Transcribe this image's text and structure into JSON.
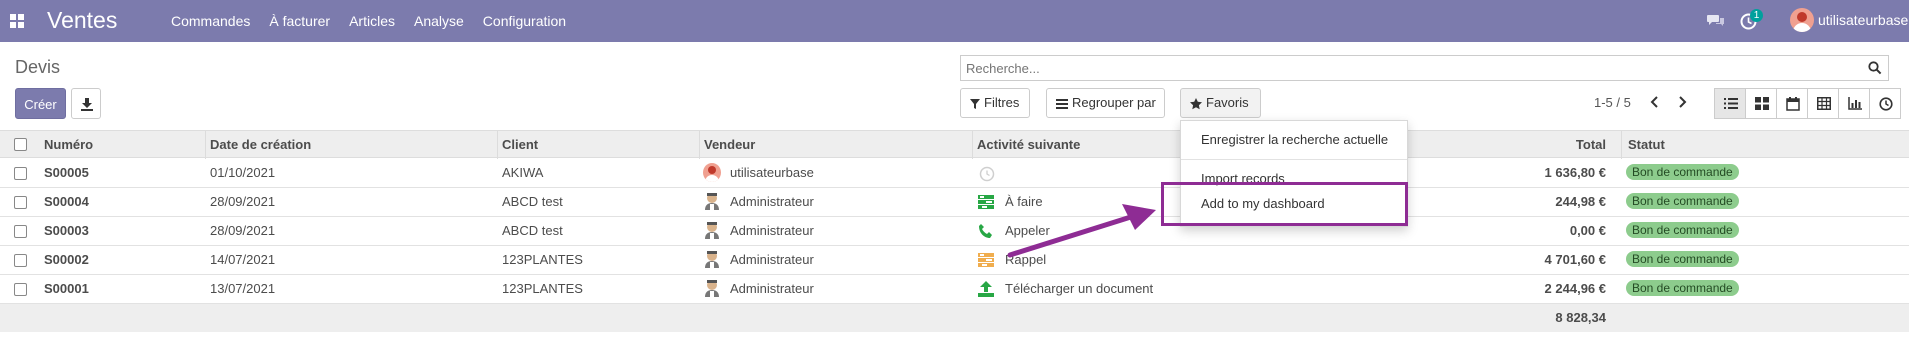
{
  "navbar": {
    "app_title": "Ventes",
    "menu": [
      "Commandes",
      "À facturer",
      "Articles",
      "Analyse",
      "Configuration"
    ],
    "activity_count": "1",
    "user_name": "utilisateurbase",
    "bg_color": "#7c7bad"
  },
  "control": {
    "title": "Devis",
    "create_label": "Créer",
    "search_placeholder": "Recherche...",
    "filters_label": "Filtres",
    "groupby_label": "Regrouper par",
    "favorites_label": "Favoris",
    "pager": "1-5 / 5",
    "views": [
      "list-icon",
      "kanban-icon",
      "calendar-icon",
      "pivot-icon",
      "graph-icon",
      "activity-icon"
    ]
  },
  "table": {
    "headers": [
      "Numéro",
      "Date de création",
      "Client",
      "Vendeur",
      "Activité suivante",
      "Total",
      "Statut"
    ],
    "rows": [
      {
        "numero": "S00005",
        "date": "01/10/2021",
        "client": "AKIWA",
        "vendeur": "utilisateurbase",
        "vendeur_icon": "user-avatar",
        "activite": "",
        "activite_icon": "clock-icon",
        "total": "1 636,80 €",
        "statut": "Bon de commande"
      },
      {
        "numero": "S00004",
        "date": "28/09/2021",
        "client": "ABCD test",
        "vendeur": "Administrateur",
        "vendeur_icon": "admin-avatar",
        "activite": "À faire",
        "activite_icon": "tasks-icon",
        "total": "244,98 €",
        "statut": "Bon de commande"
      },
      {
        "numero": "S00003",
        "date": "28/09/2021",
        "client": "ABCD test",
        "vendeur": "Administrateur",
        "vendeur_icon": "admin-avatar",
        "activite": "Appeler",
        "activite_icon": "phone-icon",
        "total": "0,00 €",
        "statut": "Bon de commande"
      },
      {
        "numero": "S00002",
        "date": "14/07/2021",
        "client": "123PLANTES",
        "vendeur": "Administrateur",
        "vendeur_icon": "admin-avatar",
        "activite": "Rappel",
        "activite_icon": "reminder-icon",
        "total": "4 701,60 €",
        "statut": "Bon de commande"
      },
      {
        "numero": "S00001",
        "date": "13/07/2021",
        "client": "123PLANTES",
        "vendeur": "Administrateur",
        "vendeur_icon": "admin-avatar",
        "activite": "Télécharger un document",
        "activite_icon": "upload-icon",
        "total": "2 244,96 €",
        "statut": "Bon de commande"
      }
    ],
    "sum_total": "8 828,34"
  },
  "favorites_dropdown": {
    "items": [
      "Enregistrer la recherche actuelle",
      "Import records",
      "Add to my dashboard"
    ],
    "highlighted": "Add to my dashboard",
    "annotation_color": "#8e2c94"
  }
}
